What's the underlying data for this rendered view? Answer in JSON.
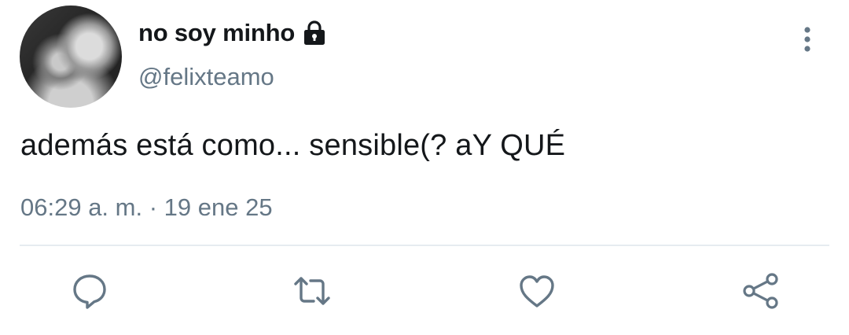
{
  "author": {
    "display_name": "no soy minho",
    "handle": "@felixteamo",
    "avatar_icon": "profile-photo",
    "protected_icon": "lock-icon"
  },
  "menu_icon": "more-vertical-icon",
  "tweet": {
    "text": "además está como... sensible(? aY QUÉ",
    "time": "06:29 a. m.",
    "separator": "·",
    "date": "19 ene 25"
  },
  "actions": {
    "reply_icon": "reply-icon",
    "retweet_icon": "retweet-icon",
    "like_icon": "heart-icon",
    "share_icon": "share-icon"
  },
  "colors": {
    "text_primary": "#14171a",
    "text_secondary": "#657786",
    "icon": "#657786",
    "divider": "#e6ecf0"
  }
}
